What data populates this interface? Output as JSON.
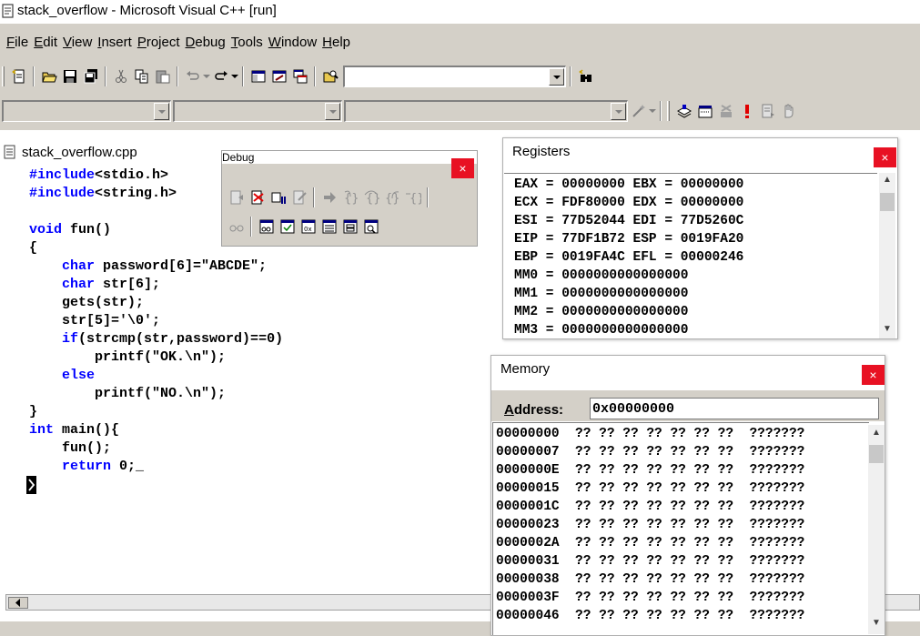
{
  "window": {
    "title": "stack_overflow - Microsoft Visual C++ [run]"
  },
  "menu": [
    {
      "label": "File",
      "ul": "F",
      "rest": "ile"
    },
    {
      "label": "Edit",
      "ul": "E",
      "rest": "dit"
    },
    {
      "label": "View",
      "ul": "V",
      "rest": "iew"
    },
    {
      "label": "Insert",
      "ul": "I",
      "rest": "nsert"
    },
    {
      "label": "Project",
      "ul": "P",
      "rest": "roject"
    },
    {
      "label": "Debug",
      "ul": "D",
      "rest": "ebug"
    },
    {
      "label": "Tools",
      "ul": "T",
      "rest": "ools"
    },
    {
      "label": "Window",
      "ul": "W",
      "rest": "indow"
    },
    {
      "label": "Help",
      "ul": "H",
      "rest": "elp"
    }
  ],
  "toolbar": {
    "find_combo_value": "",
    "wizard_combo1_value": "",
    "wizard_combo2_value": "",
    "wizard_combo3_value": ""
  },
  "editor": {
    "filename": "stack_overflow.cpp",
    "lines": [
      [
        {
          "t": "#include",
          "k": true
        },
        {
          "t": "<stdio.h>"
        }
      ],
      [
        {
          "t": "#include",
          "k": true
        },
        {
          "t": "<string.h>"
        }
      ],
      [],
      [
        {
          "t": "void",
          "k": true
        },
        {
          "t": " fun()"
        }
      ],
      [
        {
          "t": "{"
        }
      ],
      [
        {
          "t": "    "
        },
        {
          "t": "char",
          "k": true
        },
        {
          "t": " password[6]=\"ABCDE\";"
        }
      ],
      [
        {
          "t": "    "
        },
        {
          "t": "char",
          "k": true
        },
        {
          "t": " str[6];"
        }
      ],
      [
        {
          "t": "    gets(str);"
        }
      ],
      [
        {
          "t": "    str[5]='\\0';"
        }
      ],
      [
        {
          "t": "    "
        },
        {
          "t": "if",
          "k": true
        },
        {
          "t": "(strcmp(str,password)==0)"
        }
      ],
      [
        {
          "t": "        printf(\"OK.\\n\");"
        }
      ],
      [
        {
          "t": "    "
        },
        {
          "t": "else",
          "k": true
        }
      ],
      [
        {
          "t": "        printf(\"NO.\\n\");"
        }
      ],
      [
        {
          "t": "}"
        }
      ],
      [
        {
          "t": "int",
          "k": true
        },
        {
          "t": " main(){"
        }
      ],
      [
        {
          "t": "    fun();"
        }
      ],
      [
        {
          "t": "    "
        },
        {
          "t": "return",
          "k": true
        },
        {
          "t": " 0;_"
        }
      ]
    ]
  },
  "debug_window": {
    "title": "Debug",
    "close": "×"
  },
  "registers_window": {
    "title": "Registers",
    "close": "×",
    "lines": [
      "EAX = 00000000 EBX = 00000000",
      "ECX = FDF80000 EDX = 00000000",
      "ESI = 77D52044 EDI = 77D5260C",
      "EIP = 77DF1B72 ESP = 0019FA20",
      "EBP = 0019FA4C EFL = 00000246",
      "MM0 = 0000000000000000",
      "MM1 = 0000000000000000",
      "MM2 = 0000000000000000",
      "MM3 = 0000000000000000"
    ]
  },
  "memory_window": {
    "title": "Memory",
    "close": "×",
    "address_label": "Address:",
    "address_value": "0x00000000",
    "rows": [
      {
        "addr": "00000000",
        "bytes": "?? ?? ?? ?? ?? ?? ??",
        "ascii": "???????"
      },
      {
        "addr": "00000007",
        "bytes": "?? ?? ?? ?? ?? ?? ??",
        "ascii": "???????"
      },
      {
        "addr": "0000000E",
        "bytes": "?? ?? ?? ?? ?? ?? ??",
        "ascii": "???????"
      },
      {
        "addr": "00000015",
        "bytes": "?? ?? ?? ?? ?? ?? ??",
        "ascii": "???????"
      },
      {
        "addr": "0000001C",
        "bytes": "?? ?? ?? ?? ?? ?? ??",
        "ascii": "???????"
      },
      {
        "addr": "00000023",
        "bytes": "?? ?? ?? ?? ?? ?? ??",
        "ascii": "???????"
      },
      {
        "addr": "0000002A",
        "bytes": "?? ?? ?? ?? ?? ?? ??",
        "ascii": "???????"
      },
      {
        "addr": "00000031",
        "bytes": "?? ?? ?? ?? ?? ?? ??",
        "ascii": "???????"
      },
      {
        "addr": "00000038",
        "bytes": "?? ?? ?? ?? ?? ?? ??",
        "ascii": "???????"
      },
      {
        "addr": "0000003F",
        "bytes": "?? ?? ?? ?? ?? ?? ??",
        "ascii": "???????"
      },
      {
        "addr": "00000046",
        "bytes": "?? ?? ?? ?? ?? ?? ??",
        "ascii": "???????"
      }
    ]
  },
  "colors": {
    "keyword": "#0000ff",
    "chrome": "#d4d0c8",
    "close_button": "#e81123"
  }
}
